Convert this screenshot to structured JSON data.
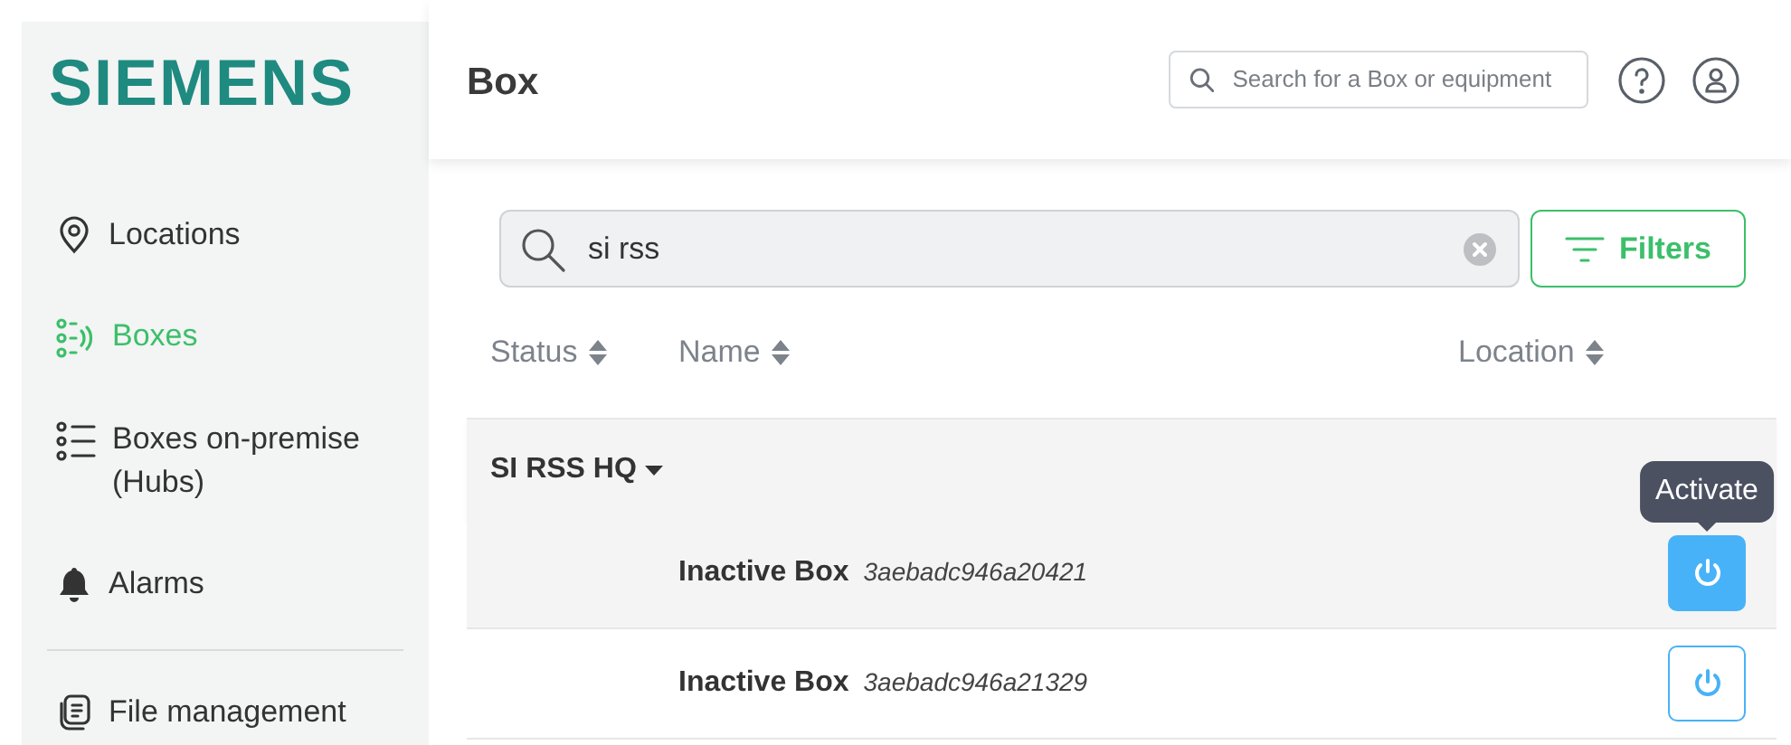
{
  "sidebar": {
    "logo": "SIEMENS",
    "groups": [
      [
        {
          "label": "Locations",
          "selected": false
        },
        {
          "label": "Boxes",
          "selected": true
        },
        {
          "label": "Boxes on-premise (Hubs)",
          "selected": false
        },
        {
          "label": "Alarms",
          "selected": false
        }
      ],
      [
        {
          "label": "File management",
          "selected": false
        }
      ]
    ]
  },
  "header": {
    "title": "Box",
    "search": {
      "placeholder": "Search for a Box or equipment"
    }
  },
  "filter_bar": {
    "search": {
      "value": "si rss"
    },
    "filters_button": "Filters"
  },
  "table": {
    "columns": [
      "Status",
      "Name",
      "Location"
    ],
    "groups": [
      {
        "name": "SI RSS HQ",
        "expanded": true,
        "rows": [
          {
            "name": "Inactive Box",
            "id": "3aebadc946a20421",
            "hovered": true,
            "tooltip": "Activate"
          },
          {
            "name": "Inactive Box",
            "id": "3aebadc946a21329",
            "hovered": false
          }
        ]
      }
    ]
  }
}
